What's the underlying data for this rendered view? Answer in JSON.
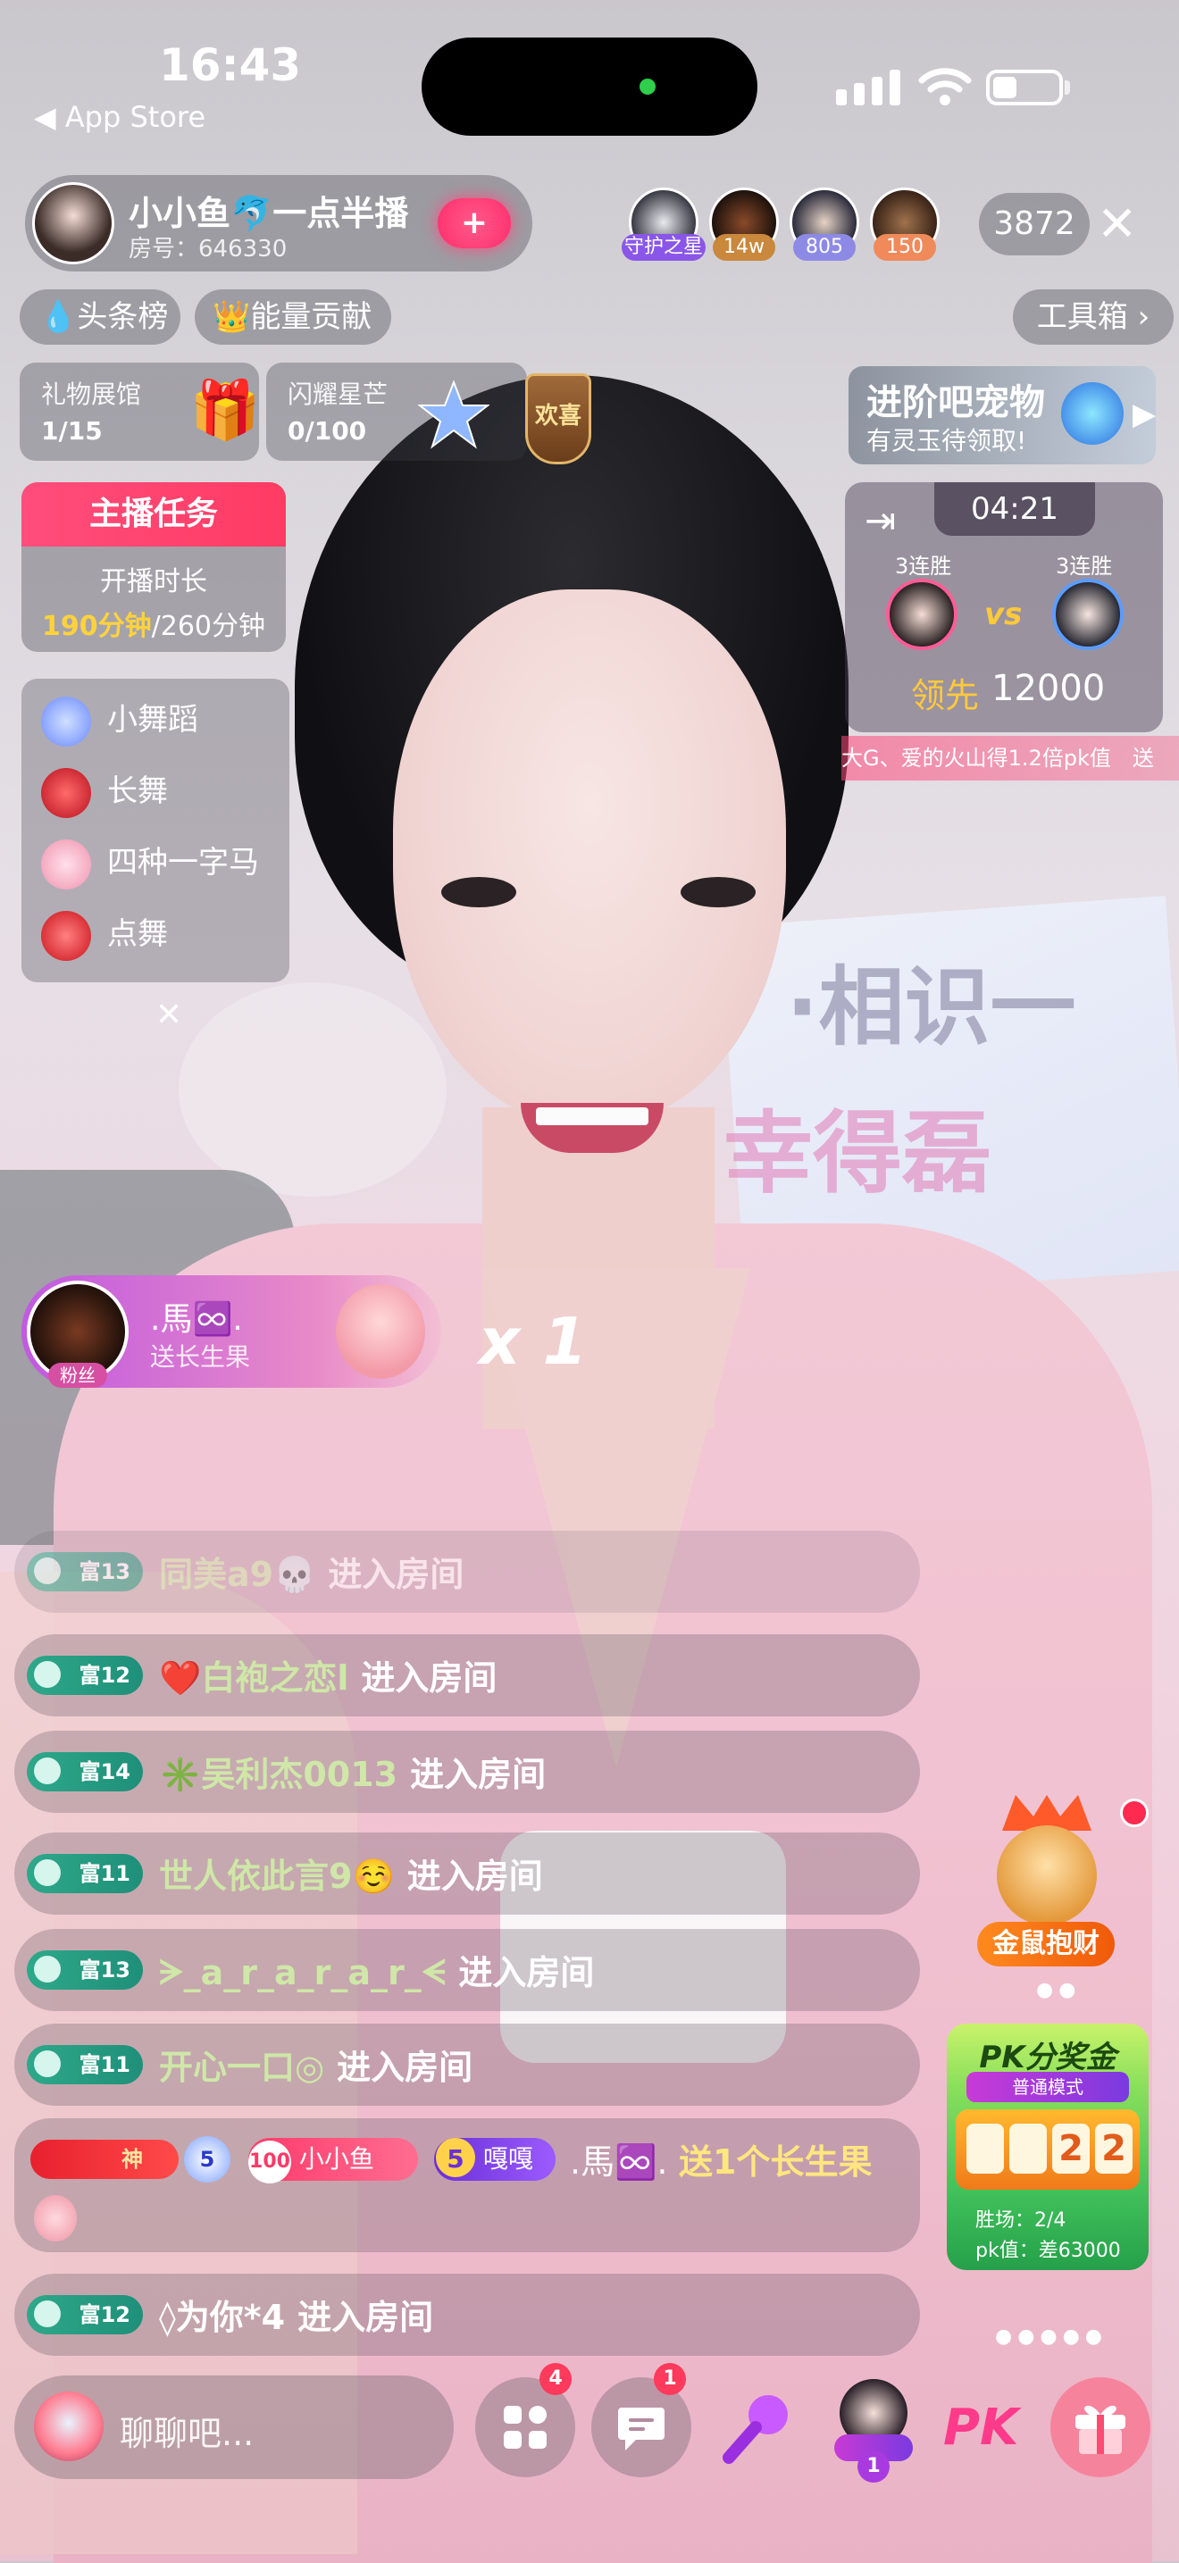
{
  "status_bar": {
    "time": "16:43",
    "back_label": "◀ App Store"
  },
  "host": {
    "name": "小小鱼🐬一点半播",
    "room_id": "房号：646330",
    "follow_label": "+"
  },
  "viewers": [
    {
      "badge": "守护之星",
      "badge_color": "#8a56e8"
    },
    {
      "badge": "14w",
      "badge_color": "#c9883c"
    },
    {
      "badge": "805",
      "badge_color": "#8d8ae6"
    },
    {
      "badge": "150",
      "badge_color": "#f08a5a"
    }
  ],
  "viewer_count": "3872",
  "chips": {
    "headlines": "头条榜",
    "energy": "能量贡献",
    "toolbox": "工具箱 ›"
  },
  "gift_hall": {
    "title": "礼物展馆",
    "value": "1/15"
  },
  "star": {
    "title": "闪耀星芒",
    "value": "0/100"
  },
  "welcome_badge": "欢喜",
  "pet": {
    "title": "进阶吧宠物",
    "subtitle": "有灵玉待领取!"
  },
  "task": {
    "header": "主播任务",
    "label": "开播时长",
    "progress": "190分钟",
    "total": "/260分钟"
  },
  "dances": [
    {
      "label": "小舞蹈",
      "color": "#9fb8ff"
    },
    {
      "label": "长舞",
      "color": "#e0233a"
    },
    {
      "label": "四种一字马",
      "color": "#f5a0b8"
    },
    {
      "label": "点舞",
      "color": "#e82a2a"
    }
  ],
  "pk": {
    "timer": "04:21",
    "left_streak": "3连胜",
    "right_streak": "3连胜",
    "vs": "vs",
    "lead_label": "领先",
    "lead_value": "12000",
    "ticker": "大G、爱的火山得1.2倍pk值　送"
  },
  "gift": {
    "user": ".馬♾️.",
    "action": "送长生果",
    "fan_tag": "粉丝",
    "combo": "x 1"
  },
  "messages": [
    {
      "level": "富13",
      "user": "同美a9💀",
      "action": "进入房间"
    },
    {
      "level": "富12",
      "user": "❤️白袍之恋l",
      "action": "进入房间"
    },
    {
      "level": "富14",
      "user": "✳️吴利杰0013",
      "action": "进入房间"
    },
    {
      "level": "富11",
      "user": "世人依此言9☺️",
      "action": "进入房间"
    },
    {
      "level": "富13",
      "user": "ᗒ_a_r_a_r_a_r_ᗕ",
      "action": "进入房间"
    },
    {
      "level": "富11",
      "user": "开心一口◎",
      "action": "进入房间"
    }
  ],
  "gift_msg": {
    "god": "神",
    "level5": "5",
    "fan_level": "100",
    "fan_name": "小小鱼",
    "badge_level": "5",
    "badge_name": "嘎嘎",
    "user": ".馬♾️.",
    "action": "送1个长生果"
  },
  "last_msg": {
    "level": "富12",
    "user": "◊为你*4",
    "action": "进入房间"
  },
  "mouse": {
    "label": "金鼠抱财"
  },
  "pk_prize": {
    "title": "PK分奖金",
    "mode": "普通模式",
    "slots": [
      "",
      "",
      "2",
      "2"
    ],
    "wins": "胜场：2/4",
    "value": "pk值：差63000"
  },
  "bottom": {
    "placeholder": "聊聊吧...",
    "apps_badge": "4",
    "msg_badge": "1",
    "pk_label": "PK",
    "mic_badge": "1"
  }
}
